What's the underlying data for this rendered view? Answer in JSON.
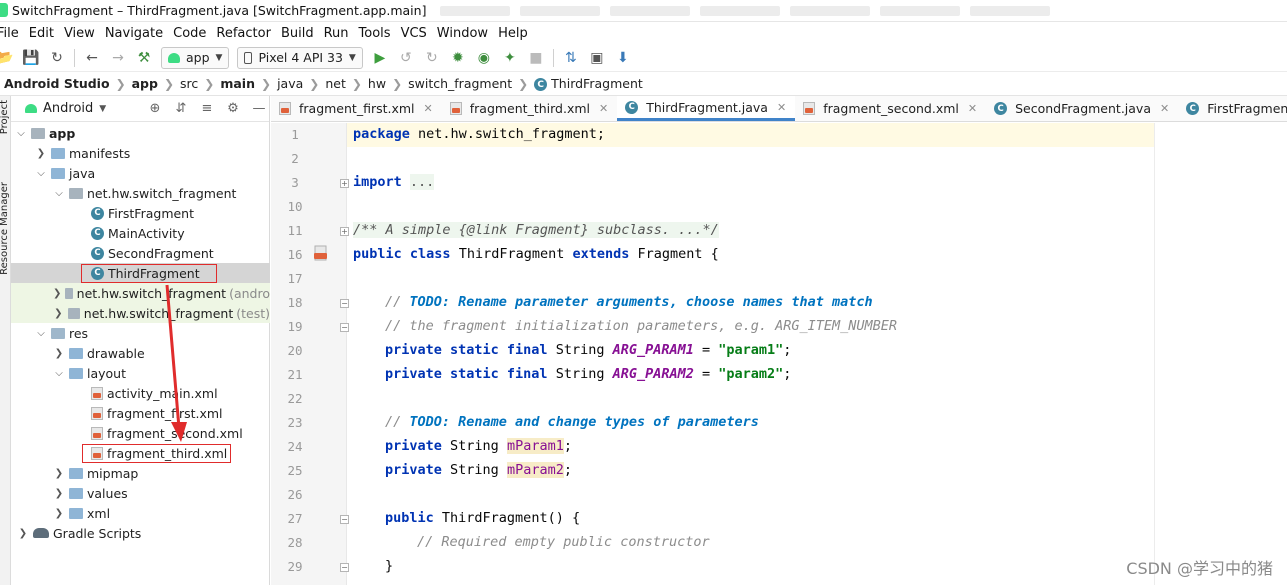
{
  "window": {
    "title": "SwitchFragment – ThirdFragment.java [SwitchFragment.app.main]"
  },
  "menu": [
    "File",
    "Edit",
    "View",
    "Navigate",
    "Code",
    "Refactor",
    "Build",
    "Run",
    "Tools",
    "VCS",
    "Window",
    "Help"
  ],
  "toolbar": {
    "run_config": "app",
    "device": "Pixel 4 API 33"
  },
  "breadcrumb": [
    "Android Studio",
    "app",
    "src",
    "main",
    "java",
    "net",
    "hw",
    "switch_fragment",
    "ThirdFragment"
  ],
  "side_strip": {
    "project_label": "Project",
    "resource_label": "Resource Manager"
  },
  "project": {
    "view_mode": "Android",
    "tree": [
      {
        "label": "app",
        "suffix": ""
      },
      {
        "label": "manifests",
        "suffix": ""
      },
      {
        "label": "java",
        "suffix": ""
      },
      {
        "label": "net.hw.switch_fragment",
        "suffix": ""
      },
      {
        "label": "FirstFragment",
        "suffix": ""
      },
      {
        "label": "MainActivity",
        "suffix": ""
      },
      {
        "label": "SecondFragment",
        "suffix": ""
      },
      {
        "label": "ThirdFragment",
        "suffix": ""
      },
      {
        "label": "net.hw.switch_fragment",
        "suffix": "(andro"
      },
      {
        "label": "net.hw.switch_fragment",
        "suffix": "(test)"
      },
      {
        "label": "res",
        "suffix": ""
      },
      {
        "label": "drawable",
        "suffix": ""
      },
      {
        "label": "layout",
        "suffix": ""
      },
      {
        "label": "activity_main.xml",
        "suffix": ""
      },
      {
        "label": "fragment_first.xml",
        "suffix": ""
      },
      {
        "label": "fragment_second.xml",
        "suffix": ""
      },
      {
        "label": "fragment_third.xml",
        "suffix": ""
      },
      {
        "label": "mipmap",
        "suffix": ""
      },
      {
        "label": "values",
        "suffix": ""
      },
      {
        "label": "xml",
        "suffix": ""
      },
      {
        "label": "Gradle Scripts",
        "suffix": ""
      }
    ]
  },
  "tabs": [
    {
      "label": "fragment_first.xml",
      "active": false
    },
    {
      "label": "fragment_third.xml",
      "active": false
    },
    {
      "label": "ThirdFragment.java",
      "active": true
    },
    {
      "label": "fragment_second.xml",
      "active": false
    },
    {
      "label": "SecondFragment.java",
      "active": false
    },
    {
      "label": "FirstFragment.java",
      "active": false
    }
  ],
  "editor": {
    "line_numbers": [
      "1",
      "2",
      "3",
      "10",
      "11",
      "16",
      "17",
      "18",
      "19",
      "20",
      "21",
      "22",
      "23",
      "24",
      "25",
      "26",
      "27",
      "28",
      "29"
    ],
    "code": {
      "l1_kw": "package",
      "l1_rest": " net.hw.switch_fragment;",
      "l3_kw": "import",
      "l3_fold": "...",
      "l11": "/** A simple {@link Fragment} subclass. ...*/",
      "l16_kw1": "public",
      "l16_kw2": "class",
      "l16_name": " ThirdFragment ",
      "l16_kw3": "extends",
      "l16_rest": " Fragment {",
      "l18_cm": "// ",
      "l18_todo": "TODO: Rename parameter arguments, choose names that match",
      "l19": "// the fragment initialization parameters, e.g. ARG_ITEM_NUMBER",
      "l20_kw": "private static final",
      "l20_type": " String ",
      "l20_const": "ARG_PARAM1",
      "l20_eq": " = ",
      "l20_str": "\"param1\"",
      "l20_end": ";",
      "l21_kw": "private static final",
      "l21_type": " String ",
      "l21_const": "ARG_PARAM2",
      "l21_eq": " = ",
      "l21_str": "\"param2\"",
      "l21_end": ";",
      "l23_cm": "// ",
      "l23_todo": "TODO: Rename and change types of parameters",
      "l24_kw": "private",
      "l24_type": " String ",
      "l24_field": "mParam1",
      "l24_end": ";",
      "l25_kw": "private",
      "l25_type": " String ",
      "l25_field": "mParam2",
      "l25_end": ";",
      "l27_kw": "public",
      "l27_rest": " ThirdFragment() {",
      "l28": "// Required empty public constructor",
      "l29": "}"
    }
  },
  "watermark": "CSDN @\u0001\u0001\u0001\u0001学习中的猪",
  "colors": {
    "keyword": "#0033b3",
    "string": "#067d17",
    "comment": "#8c8c8c",
    "todo": "#0073bf",
    "constant": "#871094",
    "active_tab_underline": "#4083c9",
    "annotation_red": "#e02c2c"
  }
}
